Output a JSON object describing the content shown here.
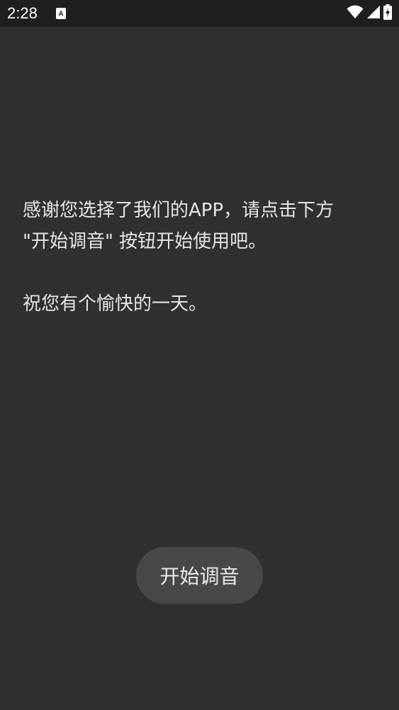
{
  "status_bar": {
    "time": "2:28",
    "icons": [
      "text-notification-icon",
      "wifi-icon",
      "cellular-signal-icon",
      "battery-charging-icon"
    ]
  },
  "message": {
    "line1": "感谢您选择了我们的APP，请点击下方",
    "line2": "\"开始调音\" 按钮开始使用吧。",
    "line3": "祝您有个愉快的一天。"
  },
  "start_button": {
    "label": "开始调音"
  },
  "colors": {
    "background": "#303030",
    "status_bar": "#1f1f1f",
    "button": "#484848",
    "text": "#e6e6e6"
  }
}
